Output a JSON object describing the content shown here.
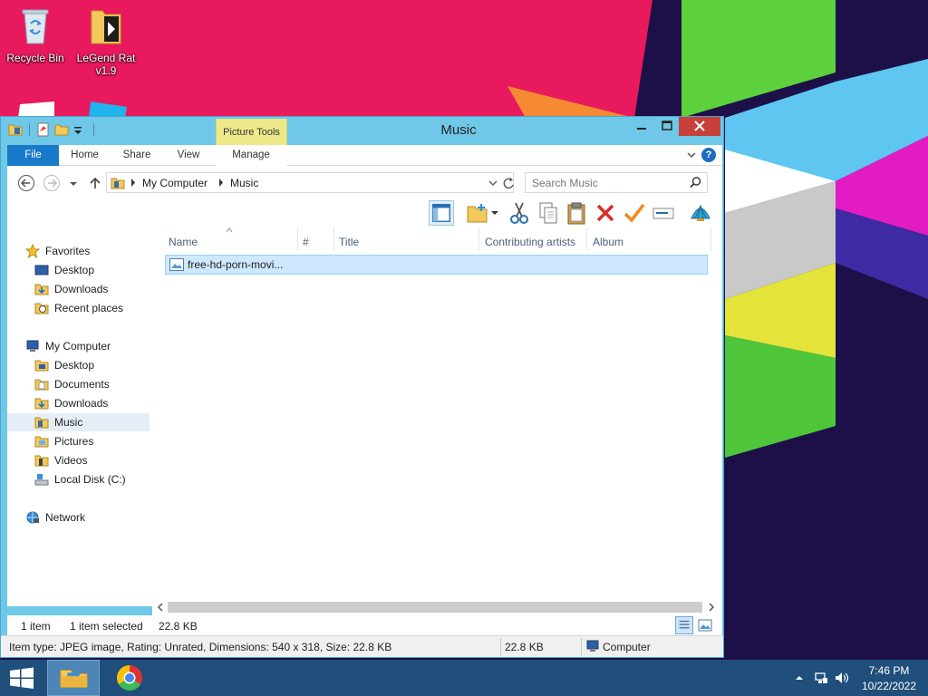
{
  "desktop": {
    "icons": [
      {
        "label": "Recycle Bin",
        "icon": "recycle-bin-icon"
      },
      {
        "label": "LeGend Rat v1.9",
        "icon": "folder-icon"
      }
    ]
  },
  "window": {
    "title": "Music",
    "context_tab_label": "Picture Tools",
    "ribbon_tabs": {
      "file": "File",
      "home": "Home",
      "share": "Share",
      "view": "View",
      "manage": "Manage"
    },
    "address": {
      "crumbs": [
        "My Computer",
        "Music"
      ]
    },
    "search": {
      "placeholder": "Search Music"
    },
    "toolbar_icons": [
      "preview-pane-icon",
      "new-folder-icon",
      "cut-icon",
      "copy-icon",
      "paste-icon",
      "delete-icon",
      "check-icon",
      "rename-icon",
      "shell-icon"
    ],
    "nav": {
      "favorites_label": "Favorites",
      "favorites": [
        "Desktop",
        "Downloads",
        "Recent places"
      ],
      "computer_label": "My Computer",
      "computer": [
        "Desktop",
        "Documents",
        "Downloads",
        "Music",
        "Pictures",
        "Videos",
        "Local Disk (C:)"
      ],
      "selected": "Music",
      "network_label": "Network"
    },
    "columns": [
      "Name",
      "#",
      "Title",
      "Contributing artists",
      "Album"
    ],
    "files": [
      {
        "name": "free-hd-porn-movi...",
        "type": "image"
      }
    ],
    "status": {
      "count": "1 item",
      "selected": "1 item selected",
      "size": "22.8 KB"
    },
    "infobar": {
      "details": "Item type: JPEG image, Rating: Unrated, Dimensions: 540 x 318, Size: 22.8 KB",
      "size": "22.8 KB",
      "location": "Computer"
    }
  },
  "taskbar": {
    "time": "7:46 PM",
    "date": "10/22/2022",
    "apps": [
      "file-explorer-icon",
      "chrome-icon"
    ]
  },
  "colors": {
    "window_frame": "#6fc8e8",
    "file_tab": "#1979ca",
    "context_tab": "#ede98a",
    "close_button": "#c7413a",
    "selection": "#cde8ff",
    "taskbar": "#1f4f7a"
  }
}
